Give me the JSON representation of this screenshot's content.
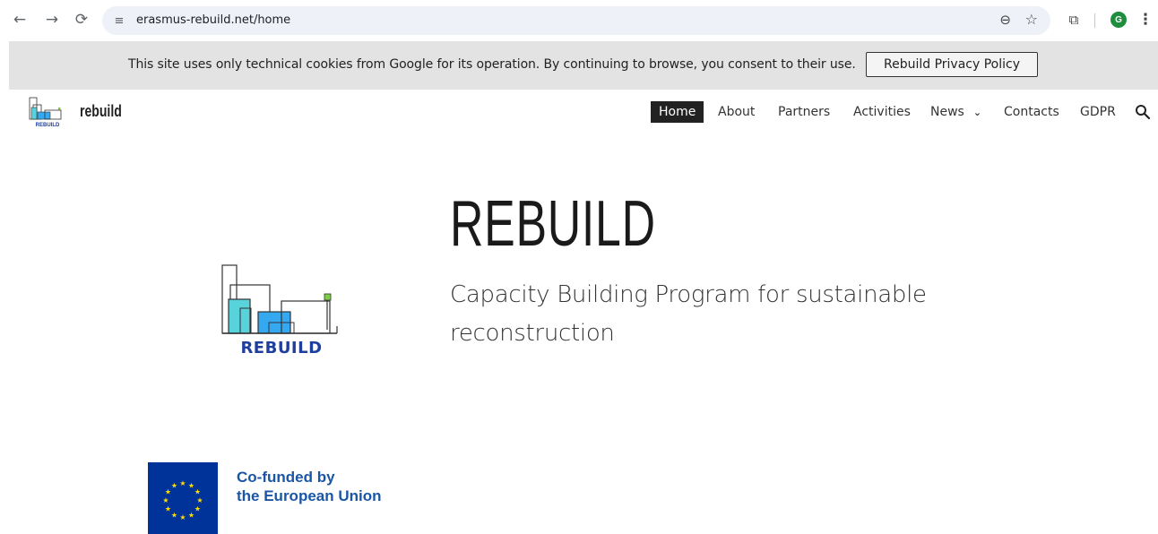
{
  "browser": {
    "url": "erasmus-rebuild.net/home",
    "profile_initial": "G",
    "icons": [
      "back-arrow-icon",
      "forward-arrow-icon",
      "reload-icon",
      "site-info-icon",
      "zoom-icon",
      "bookmark-star-icon",
      "extensions-icon",
      "menu-dots-icon"
    ]
  },
  "cookie_banner": {
    "message": "This site uses only technical cookies from Google for its operation. By continuing to browse, you consent to their use.",
    "policy_button": "Rebuild Privacy Policy"
  },
  "header": {
    "site_name": "rebuild",
    "nav": [
      {
        "label": "Home",
        "active": true
      },
      {
        "label": "About"
      },
      {
        "label": "Partners"
      },
      {
        "label": "Activities"
      },
      {
        "label": "News",
        "has_dropdown": true
      },
      {
        "label": "Contacts"
      },
      {
        "label": "GDPR"
      }
    ]
  },
  "hero": {
    "logo_text": "REBUILD",
    "title": "REBUILD",
    "subtitle": "Capacity Building Program for sustainable reconstruction"
  },
  "eu": {
    "line1": "Co-funded by",
    "line2": "the European Union"
  },
  "colors": {
    "logo_blue": "#1f3f9e",
    "logo_cyan": "#58d3db",
    "logo_sky": "#35a9f0",
    "logo_green": "#7ccf45",
    "eu_blue": "#003399",
    "eu_star": "#ffdd00"
  }
}
